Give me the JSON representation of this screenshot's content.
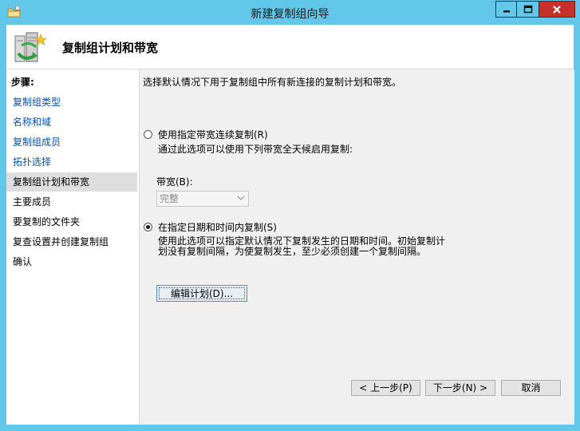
{
  "window": {
    "title": "新建复制组向导"
  },
  "header": {
    "title": "复制组计划和带宽"
  },
  "sidebar": {
    "heading": "步骤:",
    "items": [
      {
        "label": "复制组类型"
      },
      {
        "label": "名称和域"
      },
      {
        "label": "复制组成员"
      },
      {
        "label": "拓扑选择"
      },
      {
        "label": "复制组计划和带宽"
      },
      {
        "label": "主要成员"
      },
      {
        "label": "要复制的文件夹"
      },
      {
        "label": "复查设置并创建复制组"
      },
      {
        "label": "确认"
      }
    ]
  },
  "main": {
    "description": "选择默认情况下用于复制组中所有新连接的复制计划和带宽。",
    "option_full": {
      "label": "使用指定带宽连续复制(R)",
      "note": "通过此选项可以使用下列带宽全天候启用复制:",
      "selected": false
    },
    "bandwidth": {
      "label": "带宽(B):",
      "value": "完整"
    },
    "option_schedule": {
      "label": "在指定日期和时间内复制(S)",
      "note_line1": "使用此选项可以指定默认情况下复制发生的日期和时间。初始复制计",
      "note_line2": "划没有复制间隔，为使复制发生，至少必须创建一个复制间隔。",
      "selected": true
    },
    "edit_schedule_label": "编辑计划(D)..."
  },
  "footer": {
    "prev_label": "< 上一步(P)",
    "next_label": "下一步(N) >",
    "cancel_label": "取消"
  }
}
